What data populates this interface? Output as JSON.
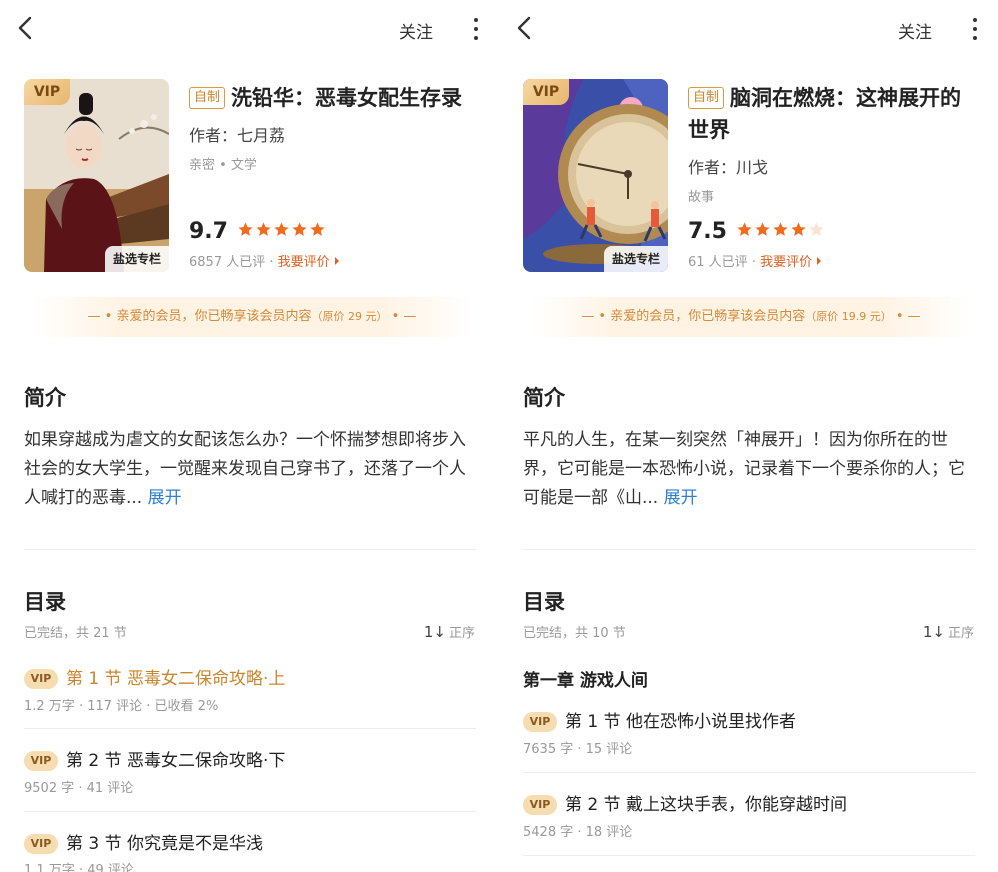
{
  "left": {
    "topbar": {
      "follow": "关注"
    },
    "cover": {
      "vip": "VIP",
      "tag": "盐选专栏"
    },
    "book": {
      "self_tag": "自制",
      "title": "洗铅华：恶毒女配生存录",
      "author": "作者：七月荔",
      "categories": "亲密 • 文学",
      "score": "9.7",
      "stars_filled": 5,
      "rating_count": "6857 人已评",
      "rate_link": "我要评价"
    },
    "member": {
      "text": "— • 亲爱的会员，你已畅享该会员内容",
      "price": "（原价 29 元）",
      "tail": "• —"
    },
    "intro": {
      "heading": "简介",
      "text": "如果穿越成为虐文的女配该怎么办？一个怀揣梦想即将步入社会的女大学生，一觉醒来发现自己穿书了，还落了一个人人喊打的恶毒...",
      "expand": "展开"
    },
    "toc": {
      "heading": "目录",
      "meta": "已完结，共 21 节",
      "order": "正序",
      "order_icon": "1↓",
      "chapters": [
        {
          "vip": "VIP",
          "title": "第 1 节  恶毒女二保命攻略·上",
          "meta": "1.2 万字 · 117 评论 · 已收看 2%"
        },
        {
          "vip": "VIP",
          "title": "第 2 节  恶毒女二保命攻略·下",
          "meta": "9502 字 · 41 评论"
        },
        {
          "vip": "VIP",
          "title": "第 3 节  你究竟是不是华浅",
          "meta": "1.1 万字 · 49 评论"
        }
      ]
    }
  },
  "right": {
    "topbar": {
      "follow": "关注"
    },
    "cover": {
      "vip": "VIP",
      "tag": "盐选专栏"
    },
    "book": {
      "self_tag": "自制",
      "title": "脑洞在燃烧：这神展开的世界",
      "author": "作者：川戈",
      "categories": "故事",
      "score": "7.5",
      "stars_filled": 4,
      "rating_count": "61 人已评",
      "rate_link": "我要评价"
    },
    "member": {
      "text": "— • 亲爱的会员，你已畅享该会员内容",
      "price": "（原价 19.9 元）",
      "tail": "• —"
    },
    "intro": {
      "heading": "简介",
      "text": "平凡的人生，在某一刻突然「神展开」！因为你所在的世界，它可能是一本恐怖小说，记录着下一个要杀你的人；它可能是一部《山...",
      "expand": "展开"
    },
    "toc": {
      "heading": "目录",
      "meta": "已完结，共 10 节",
      "order": "正序",
      "order_icon": "1↓",
      "section": "第一章  游戏人间",
      "chapters": [
        {
          "vip": "VIP",
          "title": "第 1 节  他在恐怖小说里找作者",
          "meta": "7635 字 · 15 评论"
        },
        {
          "vip": "VIP",
          "title": "第 2 节  戴上这块手表，你能穿越时间",
          "meta": "5428 字 · 18 评论"
        }
      ]
    }
  },
  "colors": {
    "accent": "#e0601e",
    "gold": "#c9852a",
    "link": "#2d7fd6",
    "star": "#f26a1b"
  }
}
